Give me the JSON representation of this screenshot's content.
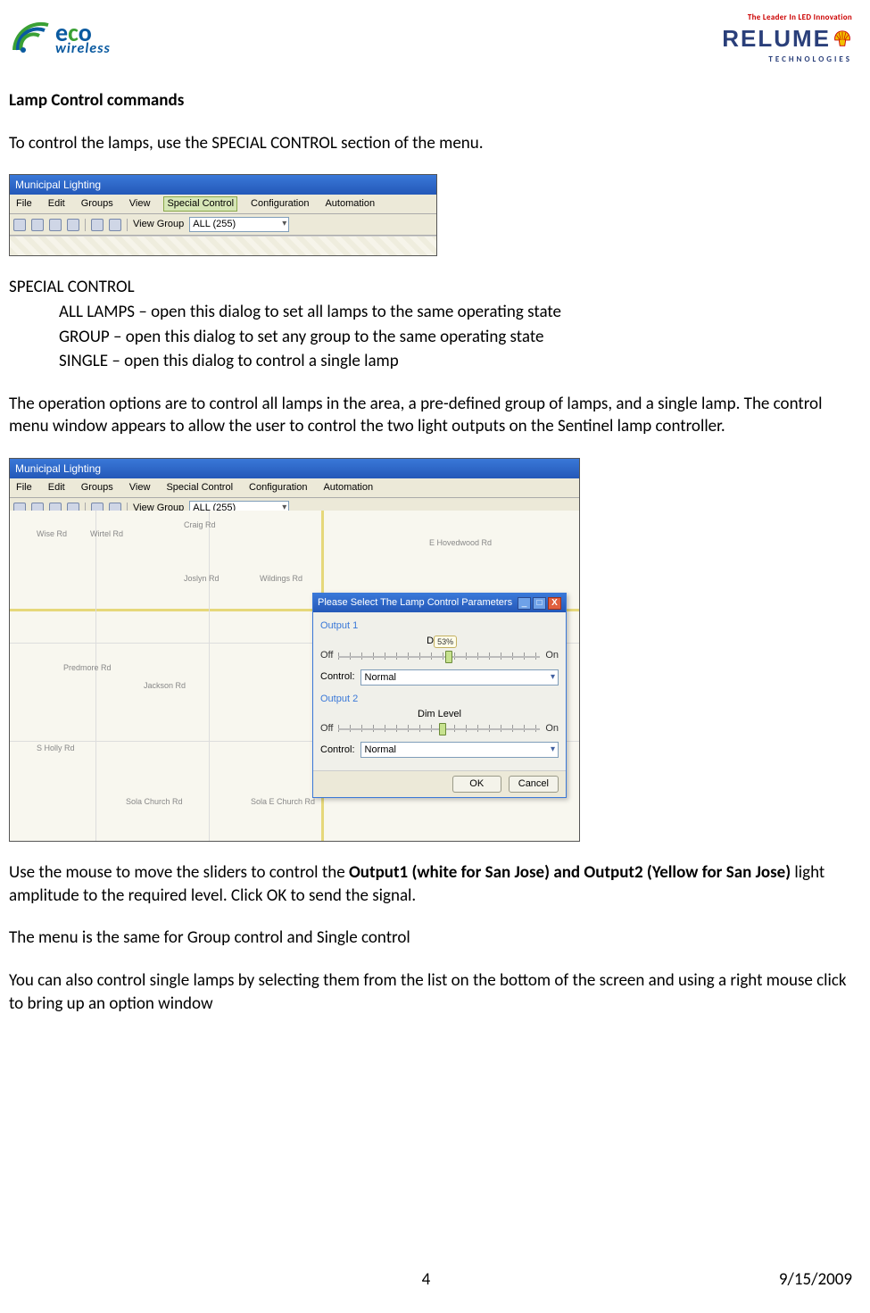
{
  "header": {
    "eco_word_e": "e",
    "eco_word_c": "c",
    "eco_word_o": "o",
    "eco_sub": "wireless",
    "relume_tag": "The Leader In LED Innovation",
    "relume_word": "RELUME",
    "relume_sub": "TECHNOLOGIES"
  },
  "doc": {
    "h2": "Lamp Control commands",
    "p1": "To control the lamps, use the SPECIAL CONTROL section of the menu.",
    "sc_hdr": "SPECIAL CONTROL",
    "sc_all": "ALL LAMPS – open this dialog to set all lamps to the same operating state",
    "sc_group": "GROUP – open this dialog to set any group to the same operating state",
    "sc_single": "SINGLE – open this dialog to control a single lamp",
    "p2": "The operation options are to control all lamps in the area, a pre-defined group of lamps, and a single lamp.  The control menu window appears to allow the user to control the two light outputs on the Sentinel lamp controller.",
    "p3a": "Use the mouse to move the sliders to control the ",
    "p3b": "Output1 (white for San Jose) and Output2 (Yellow for San Jose)",
    "p3c": " light amplitude to the required level.  Click OK to send the signal.",
    "p4": "The menu is the same for Group control and Single control",
    "p5": "You can also control single lamps by selecting them from the list on the bottom of the screen and using a right mouse click to bring up an option window"
  },
  "shot": {
    "title": "Municipal Lighting",
    "menu": {
      "file": "File",
      "edit": "Edit",
      "groups": "Groups",
      "view": "View",
      "special": "Special Control",
      "config": "Configuration",
      "auto": "Automation"
    },
    "toolbar": {
      "viewgroup_label": "View Group",
      "viewgroup_value": "ALL (255)"
    },
    "roads": {
      "r1": "Wise Rd",
      "r2": "Wirtel Rd",
      "r3": "Craig Rd",
      "r4": "Joslyn Rd",
      "r5": "S Holly Rd",
      "r6": "Sola Church Rd",
      "r7": "E Hovedwood Rd",
      "r8": "Wildings Rd",
      "r9": "Predmore Rd",
      "r10": "Jackson Rd",
      "r11": "Sola E Church Rd"
    }
  },
  "dialog": {
    "title": "Please Select The Lamp Control Parameters",
    "out1": "Output 1",
    "out2": "Output 2",
    "dim1": "Dim L",
    "dim2": "Dim Level",
    "off": "Off",
    "on": "On",
    "ctrl_label": "Control:",
    "ctrl_value": "Normal",
    "bubble": "53%",
    "ok": "OK",
    "cancel": "Cancel",
    "min_glyph": "_",
    "max_glyph": "□",
    "close_glyph": "X"
  },
  "footer": {
    "page": "4",
    "date": "9/15/2009"
  }
}
